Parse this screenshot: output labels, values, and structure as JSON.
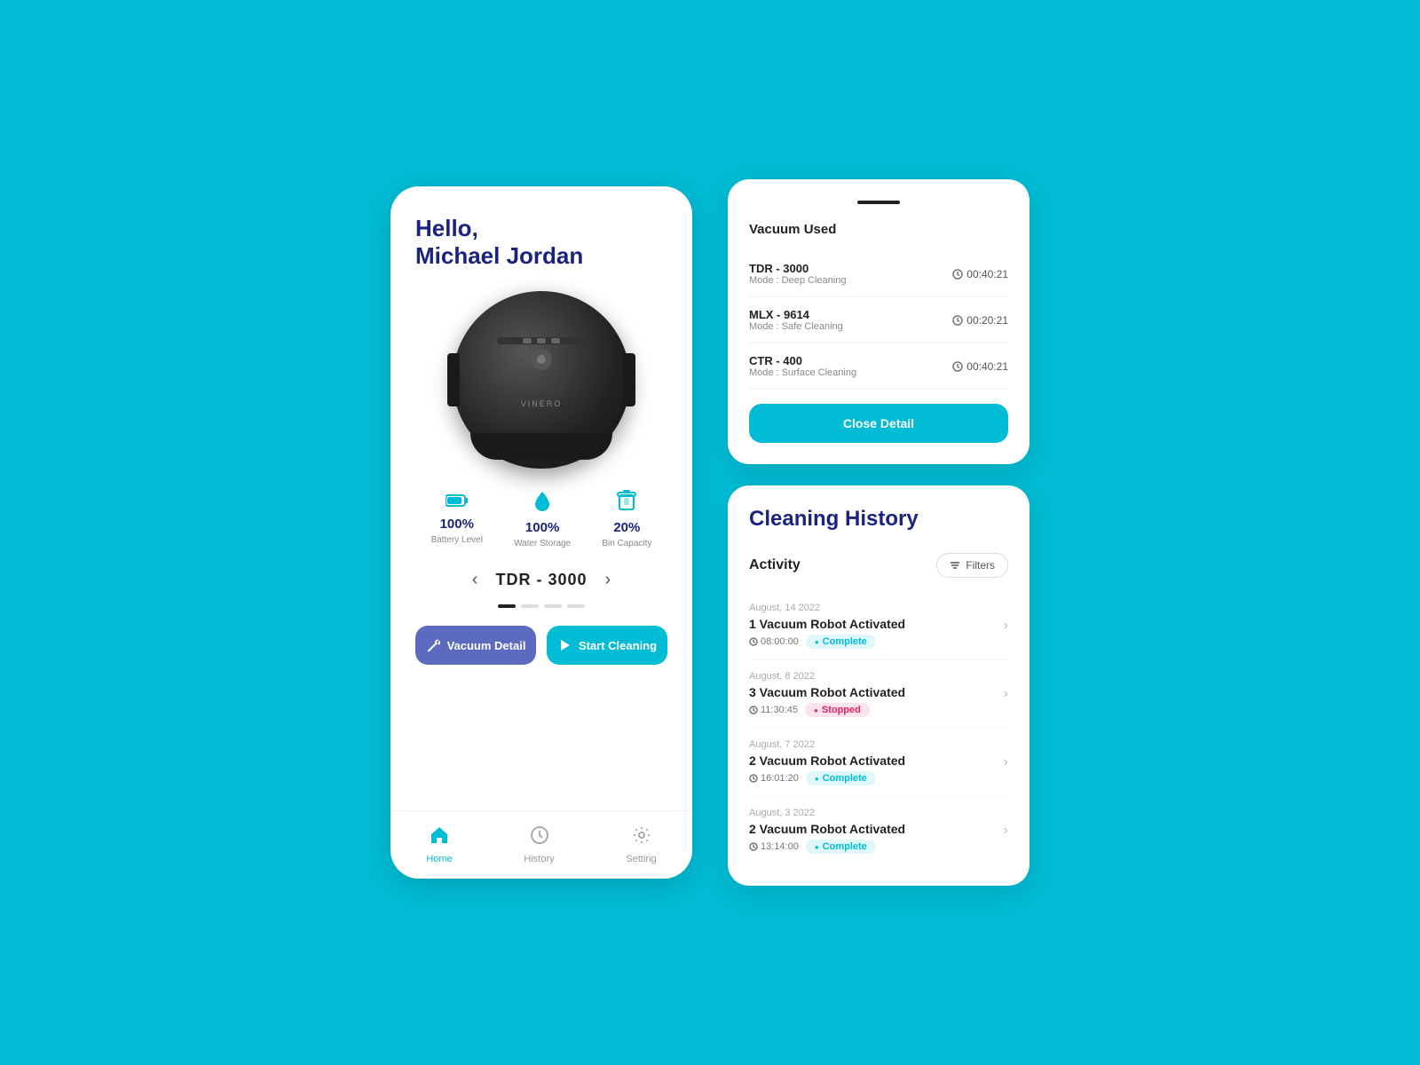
{
  "background": "#00BCD4",
  "left_card": {
    "greeting": "Hello,\nMichael Jordan",
    "greeting_line1": "Hello,",
    "greeting_line2": "Michael Jordan",
    "robot_brand": "VINERO",
    "stats": [
      {
        "icon": "battery",
        "value": "100%",
        "label": "Battery Level"
      },
      {
        "icon": "water",
        "value": "100%",
        "label": "Water Storage"
      },
      {
        "icon": "bin",
        "value": "20%",
        "label": "Bin Capacity"
      }
    ],
    "carousel": {
      "prev_arrow": "‹",
      "next_arrow": "›",
      "current_model": "TDR - 3000",
      "dots": [
        true,
        false,
        false,
        false
      ]
    },
    "buttons": {
      "vacuum_detail": "Vacuum Detail",
      "start_cleaning": "Start Cleaning"
    },
    "nav": [
      {
        "icon": "home",
        "label": "Home",
        "active": true
      },
      {
        "icon": "history",
        "label": "History",
        "active": false
      },
      {
        "icon": "setting",
        "label": "Setting",
        "active": false
      }
    ]
  },
  "detail_card": {
    "section_title": "Vacuum Used",
    "vacuums": [
      {
        "model": "TDR - 3000",
        "mode": "Mode : Deep Cleaning",
        "time": "00:40:21"
      },
      {
        "model": "MLX - 9614",
        "mode": "Mode : Safe Cleaning",
        "time": "00:20:21"
      },
      {
        "model": "CTR - 400",
        "mode": "Mode : Surface Cleaning",
        "time": "00:40:21"
      }
    ],
    "close_button": "Close Detail"
  },
  "history_card": {
    "title": "Cleaning History",
    "activity_label": "Activity",
    "filter_label": "Filters",
    "activities": [
      {
        "date": "August, 14 2022",
        "robots": "1 Vacuum Robot Activated",
        "time": "08:00:00",
        "status": "Complete",
        "status_type": "complete"
      },
      {
        "date": "August, 8 2022",
        "robots": "3 Vacuum Robot Activated",
        "time": "11:30:45",
        "status": "Stopped",
        "status_type": "stopped"
      },
      {
        "date": "August, 7 2022",
        "robots": "2 Vacuum Robot Activated",
        "time": "16:01:20",
        "status": "Complete",
        "status_type": "complete"
      },
      {
        "date": "August, 3 2022",
        "robots": "2 Vacuum Robot Activated",
        "time": "13:14:00",
        "status": "Complete",
        "status_type": "complete"
      }
    ]
  }
}
